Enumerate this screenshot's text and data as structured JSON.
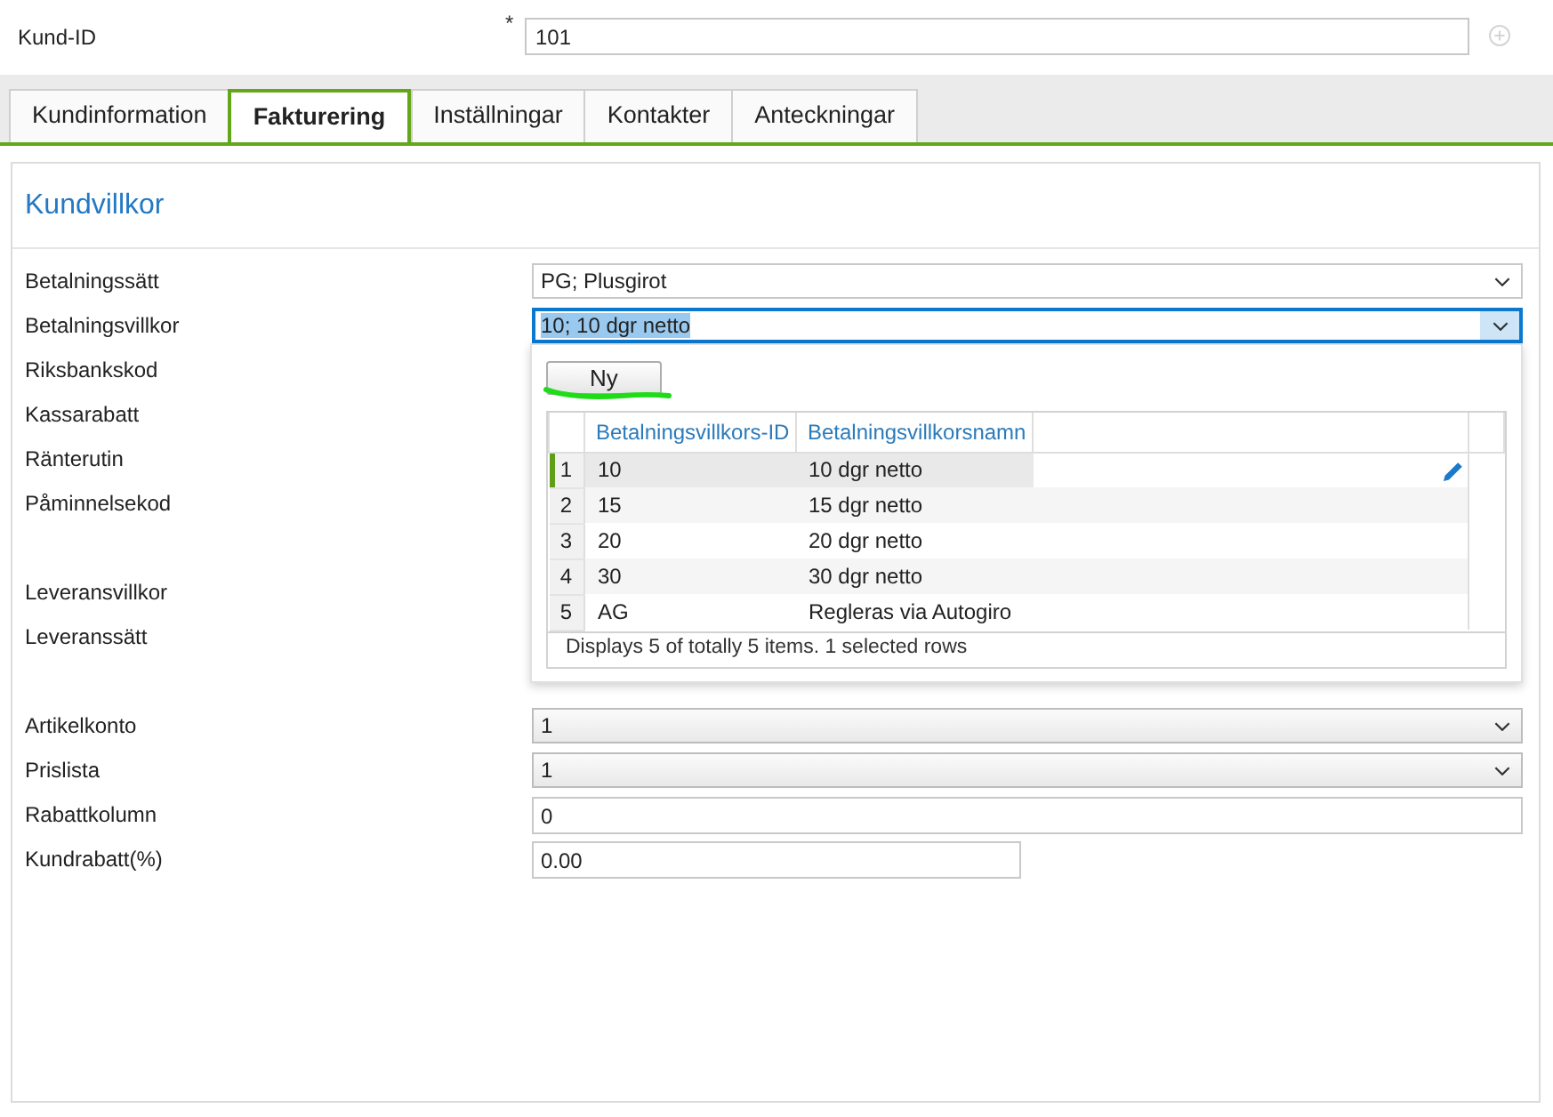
{
  "header": {
    "label": "Kund-ID",
    "required_mark": "*",
    "value": "101"
  },
  "tabs": [
    {
      "label": "Kundinformation",
      "selected": false
    },
    {
      "label": "Fakturering",
      "selected": true
    },
    {
      "label": "Inställningar",
      "selected": false
    },
    {
      "label": "Kontakter",
      "selected": false
    },
    {
      "label": "Anteckningar",
      "selected": false
    }
  ],
  "section": {
    "title": "Kundvillkor",
    "groups": [
      {
        "fields": [
          {
            "label": "Betalningssätt",
            "kind": "select",
            "value": "PG; Plusgirot",
            "expanded": false
          },
          {
            "label": "Betalningsvillkor",
            "kind": "select",
            "value": "10; 10 dgr netto",
            "expanded": true,
            "dropdown": {
              "button": "Ny",
              "columns": [
                "Betalningsvillkors-ID",
                "Betalningsvillkorsnamn"
              ],
              "rows": [
                {
                  "number": "1",
                  "cells": [
                    "10",
                    "10 dgr netto"
                  ],
                  "selected": true
                },
                {
                  "number": "2",
                  "cells": [
                    "15",
                    "15 dgr netto"
                  ],
                  "selected": false
                },
                {
                  "number": "3",
                  "cells": [
                    "20",
                    "20 dgr netto"
                  ],
                  "selected": false
                },
                {
                  "number": "4",
                  "cells": [
                    "30",
                    "30 dgr netto"
                  ],
                  "selected": false
                },
                {
                  "number": "5",
                  "cells": [
                    "AG",
                    "Regleras via Autogiro"
                  ],
                  "selected": false
                }
              ],
              "status": "Displays 5 of totally 5 items. 1 selected rows"
            }
          },
          {
            "label": "Riksbankskod",
            "kind": "label"
          },
          {
            "label": "Kassarabatt",
            "kind": "label"
          },
          {
            "label": "Ränterutin",
            "kind": "label"
          },
          {
            "label": "Påminnelsekod",
            "kind": "label"
          }
        ]
      },
      {
        "fields": [
          {
            "label": "Leveransvillkor",
            "kind": "label"
          },
          {
            "label": "Leveranssätt",
            "kind": "label"
          }
        ]
      },
      {
        "fields": [
          {
            "label": "Artikelkonto",
            "kind": "combo",
            "value": "1",
            "expanded": false
          },
          {
            "label": "Prislista",
            "kind": "combo",
            "value": "1",
            "expanded": false
          },
          {
            "label": "Rabattkolumn",
            "kind": "text",
            "value": "0"
          },
          {
            "label": "Kundrabatt(%)",
            "kind": "short-text",
            "value": "0.00"
          }
        ]
      }
    ]
  }
}
